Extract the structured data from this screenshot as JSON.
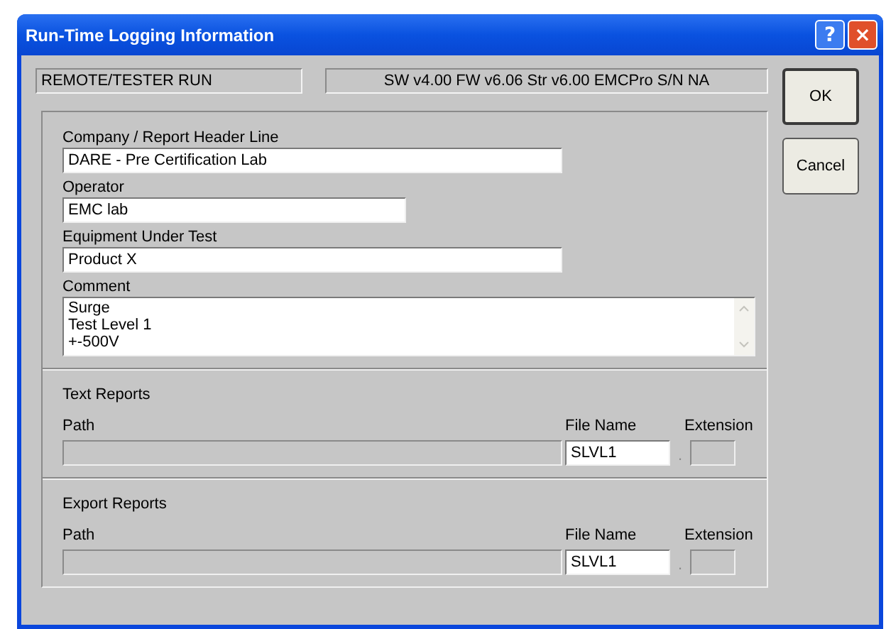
{
  "window": {
    "title": "Run-Time Logging Information",
    "help_button": "?",
    "close_button": "×"
  },
  "status": {
    "mode": "REMOTE/TESTER RUN",
    "versions": "SW v4.00  FW v6.06  Str v6.00  EMCPro  S/N NA"
  },
  "fields": [
    {
      "label": "Company / Report Header Line",
      "value": "DARE - Pre Certification Lab"
    },
    {
      "label": "Operator",
      "value": "EMC lab"
    },
    {
      "label": "Equipment Under Test",
      "value": "Product X"
    }
  ],
  "comment": {
    "label": "Comment",
    "lines": [
      "Surge",
      "Test Level 1",
      "+-500V"
    ]
  },
  "reports": [
    {
      "title": "Text Reports",
      "path_label": "Path",
      "path_disabled": true,
      "file_label": "File Name",
      "file_value": "SLVL1",
      "ext_label": "Extension",
      "separator": ".",
      "ext_disabled": true
    },
    {
      "title": "Export Reports",
      "path_label": "Path",
      "path_disabled": true,
      "file_label": "File Name",
      "file_value": "SLVL1",
      "ext_label": "Extension",
      "separator": ".",
      "ext_disabled": true
    }
  ],
  "buttons": [
    "OK",
    "Cancel"
  ]
}
